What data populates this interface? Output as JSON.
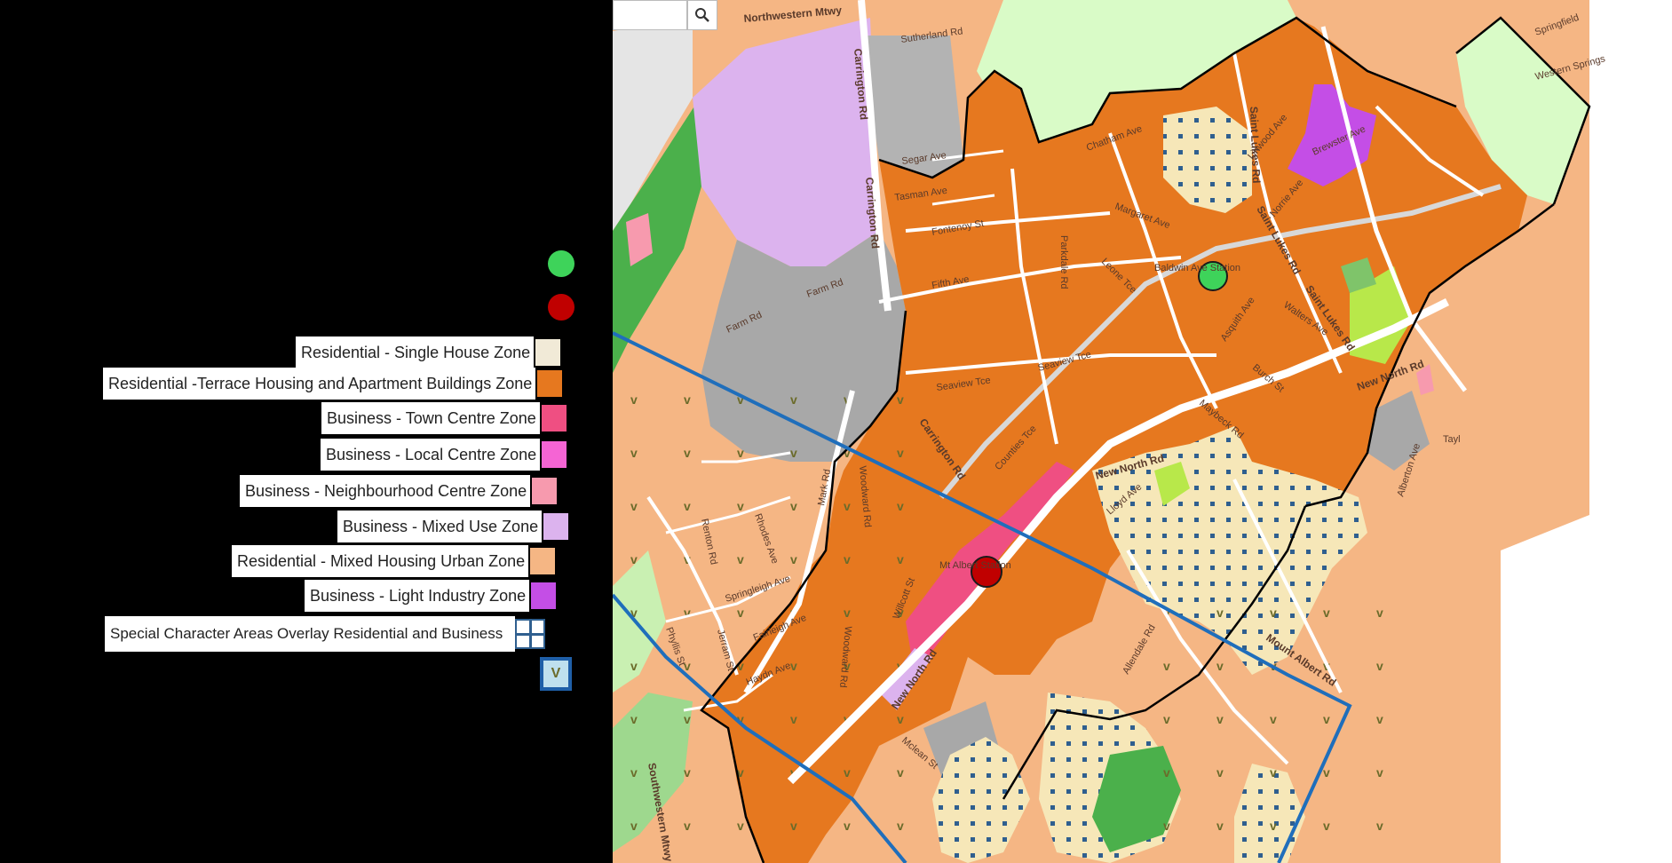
{
  "legend": {
    "items": [
      {
        "label": "Residential - Single House Zone",
        "color": "#f1ead7"
      },
      {
        "label": "Residential -Terrace Housing and Apartment Buildings Zone",
        "color": "#e6781f"
      },
      {
        "label": "Business - Town Centre Zone",
        "color": "#ef4f82"
      },
      {
        "label": "Business - Local Centre Zone",
        "color": "#f564d4"
      },
      {
        "label": "Business - Neighbourhood Centre Zone",
        "color": "#f79aae"
      },
      {
        "label": "Business - Mixed Use Zone",
        "color": "#dcb3ee"
      },
      {
        "label": "Residential - Mixed Housing Urban Zone",
        "color": "#f5b684"
      },
      {
        "label": "Business - Light Industry Zone",
        "color": "#c44ee6"
      },
      {
        "label": "Special Character Areas Overlay Residential and Business",
        "color": "#2f5f8f"
      }
    ],
    "markers": {
      "green_color": "#3ed35a",
      "red_color": "#c00000"
    },
    "v_swatch_text": "V"
  },
  "map": {
    "search": {
      "placeholder": "",
      "icon": "search-icon"
    },
    "roads": {
      "northwestern": "Northwestern Mtwy",
      "sutherland": "Sutherland Rd",
      "carrington1": "Carrington Rd",
      "carrington2": "Carrington Rd",
      "carrington3": "Carrington Rd",
      "segar": "Segar Ave",
      "tasman": "Tasman Ave",
      "fontenoy": "Fontenoy St",
      "fifth": "Fifth Ave",
      "farm1": "Farm Rd",
      "farm2": "Farm Rd",
      "seaview1": "Seaview Tce",
      "seaview2": "Seaview Tce",
      "woodward1": "Woodward Rd",
      "woodward2": "Woodward Rd",
      "renton": "Renton Rd",
      "rhodes": "Rhodes Ave",
      "mark": "Mark Rd",
      "springleigh": "Springleigh Ave",
      "fairleigh": "Fairleigh Ave",
      "haydn": "Haydn Ave",
      "jerram": "Jerram St",
      "phyllis": "Phyllis St",
      "southwestern": "Southwestern Mtwy",
      "willcott": "Willcott St",
      "mclean": "Mclean St",
      "new_north1": "New North Rd",
      "new_north2": "New North Rd",
      "new_north3": "New North Rd",
      "counties": "Counties Tce",
      "chatham": "Chatham Ave",
      "margaret": "Margaret Ave",
      "leone": "Leone Tce",
      "parkdale": "Parkdale Rd",
      "asquith": "Asquith Ave",
      "walters": "Walters Ave",
      "burch": "Burch St",
      "maybeck": "Maybeck Rd",
      "allendale": "Allendale Rd",
      "mt_albert_rd": "Mount Albert Rd",
      "saint_lukes1": "Saint Lukes Rd",
      "saint_lukes2": "Saint Lukes Rd",
      "saint_lukes3": "Saint Lukes Rd",
      "brewster": "Brewster Ave",
      "linwood": "Linwood Ave",
      "norrie": "Norrie Ave",
      "springfield": "Springfield",
      "western_springs": "Western Springs",
      "albert": "Alberton Ave",
      "baldwin": "Baldwin Ave Station",
      "mt_albert_station": "Mt Albert Station",
      "lloyd": "Lloyd Ave",
      "taylor": "Tayl"
    }
  }
}
